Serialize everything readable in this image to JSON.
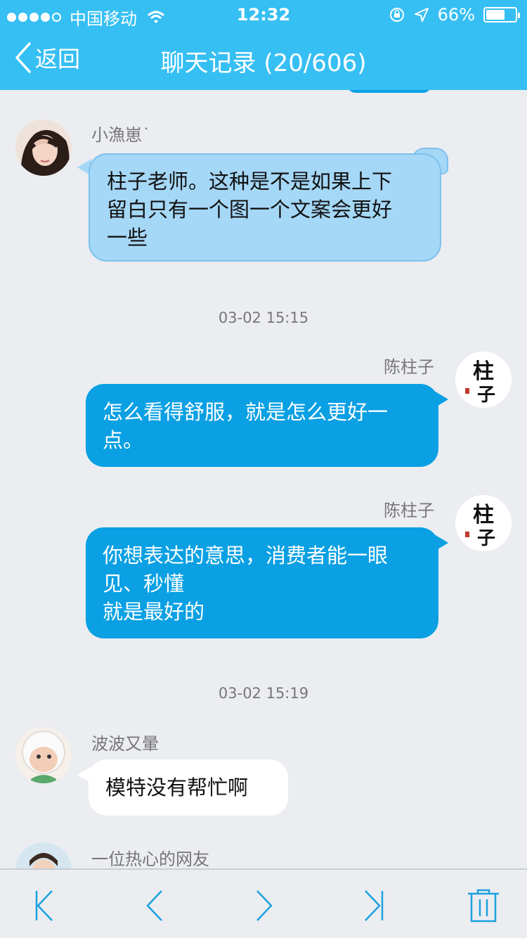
{
  "status_bar": {
    "carrier": "中国移动",
    "time": "12:32",
    "battery_text": "66%",
    "battery_level": 0.66
  },
  "nav": {
    "back_label": "返回",
    "title": "聊天记录 (20/606)"
  },
  "messages": [
    {
      "sender": "小漁崽˙",
      "text_lines": [
        "柱子老师。这种是不是如果上下",
        "留白只有一个图一个文案会更好",
        "一些"
      ]
    },
    {
      "timestamp": "03-02 15:15"
    },
    {
      "sender": "陈柱子",
      "text_lines": [
        "怎么看得舒服，就是怎么更好一",
        "点。"
      ]
    },
    {
      "sender": "陈柱子",
      "text_lines": [
        "你想表达的意思，消费者能一眼",
        "见、秒懂",
        "就是最好的"
      ]
    },
    {
      "timestamp": "03-02 15:19"
    },
    {
      "sender": "波波又暈",
      "text_lines": [
        "模特没有帮忙啊"
      ]
    },
    {
      "sender": "一位热心的网友"
    }
  ],
  "avatar_sign_text": "柱子",
  "toolbar": {
    "icons": [
      "first-page-icon",
      "prev-page-icon",
      "next-page-icon",
      "last-page-icon",
      "trash-icon"
    ]
  },
  "colors": {
    "accent": "#36bff3",
    "bubble_blue": "#0aa0e3",
    "bubble_light": "#a5d7f6",
    "background": "#ebedf1",
    "icon_blue": "#1ca1df"
  }
}
